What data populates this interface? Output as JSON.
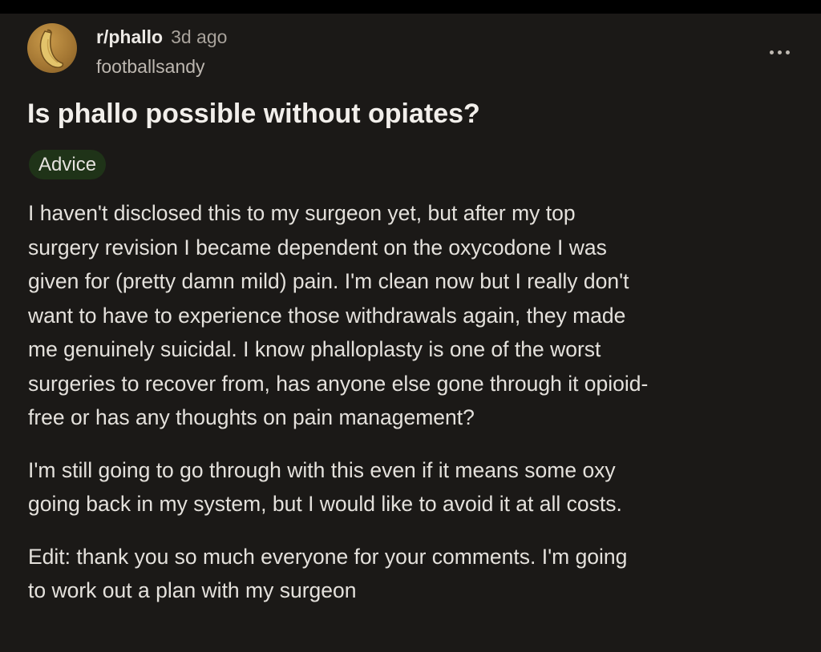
{
  "post": {
    "subreddit": "r/phallo",
    "age": "3d ago",
    "username": "footballsandy",
    "title": "Is phallo possible without opiates?",
    "flair": "Advice",
    "more_icon": "more-horizontal-icon",
    "avatar_icon": "banana-avatar",
    "body": [
      {
        "lines": [
          "I haven't disclosed this to my surgeon yet, but after my top",
          "surgery revision I became dependent on the oxycodone I was",
          "given for (pretty damn mild) pain. I'm clean now but I really don't",
          "want to have to experience those withdrawals again, they made",
          "me genuinely suicidal. I know phalloplasty is one of the worst",
          "surgeries to recover from, has anyone else gone through it opioid-",
          "free or has any thoughts on pain management?"
        ]
      },
      {
        "lines": [
          "I'm still going to go through with this even if it means some oxy",
          "going back in my system, but I would like to avoid it at all costs."
        ]
      },
      {
        "lines": [
          "Edit: thank you so much everyone for your comments. I'm going",
          "to work out a plan with my surgeon"
        ]
      }
    ]
  },
  "colors": {
    "background": "#1b1917",
    "flair_background": "#1f3318",
    "text": "#e4e1dc",
    "muted_text": "#a9a39c"
  }
}
